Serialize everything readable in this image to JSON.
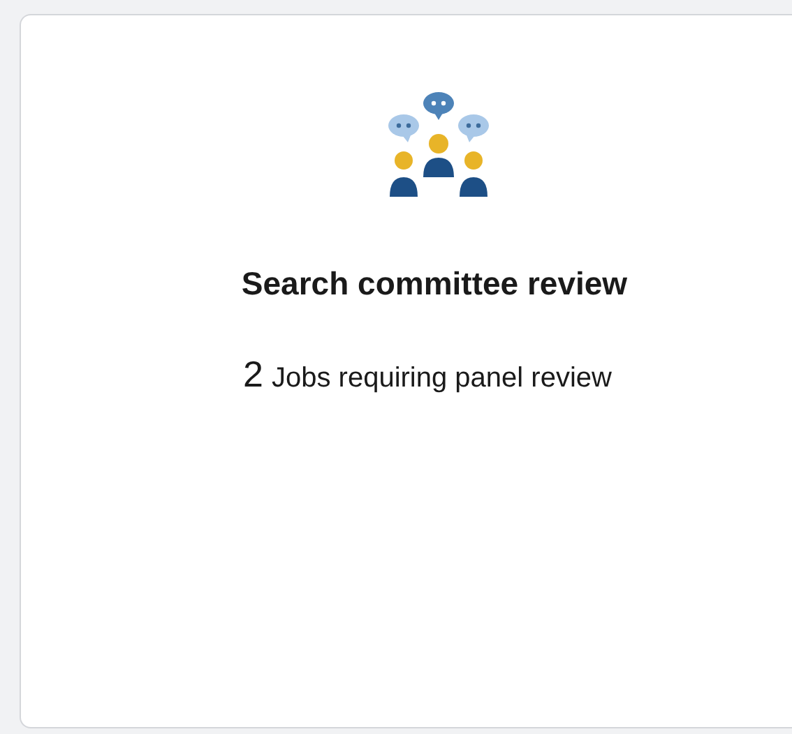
{
  "card": {
    "title": "Search committee review",
    "count": "2",
    "count_label": "Jobs requiring panel review"
  }
}
